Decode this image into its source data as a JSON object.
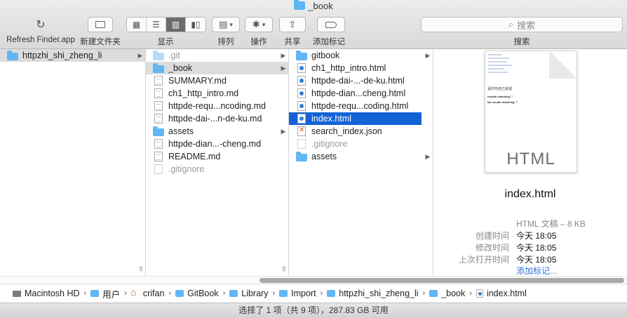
{
  "window": {
    "title": "_book"
  },
  "toolbar": {
    "refresh_label": "Refresh Finder.app",
    "new_folder_label": "新建文件夹",
    "view_label": "显示",
    "arrange_label": "排列",
    "action_label": "操作",
    "share_label": "共享",
    "tags_label": "添加标记",
    "search_placeholder": "搜索",
    "search_label": "搜索"
  },
  "columns": [
    {
      "items": [
        {
          "name": "httpzhi_shi_zheng_li",
          "icon": "folder-icon",
          "folder": true,
          "state": "path"
        }
      ]
    },
    {
      "items": [
        {
          "name": ".git",
          "icon": "folder-icon",
          "folder": true,
          "dim": true
        },
        {
          "name": "_book",
          "icon": "folder-icon",
          "folder": true,
          "state": "path"
        },
        {
          "name": "SUMMARY.md",
          "icon": "document-icon"
        },
        {
          "name": "ch1_http_intro.md",
          "icon": "document-icon"
        },
        {
          "name": "httpde-requ...ncoding.md",
          "icon": "document-icon"
        },
        {
          "name": "httpde-dai-...n-de-ku.md",
          "icon": "document-icon"
        },
        {
          "name": "assets",
          "icon": "folder-icon",
          "folder": true
        },
        {
          "name": "httpde-dian...-cheng.md",
          "icon": "document-icon"
        },
        {
          "name": "README.md",
          "icon": "document-icon"
        },
        {
          "name": ".gitignore",
          "icon": "document-icon",
          "dim": true
        }
      ]
    },
    {
      "items": [
        {
          "name": "gitbook",
          "icon": "folder-icon",
          "folder": true
        },
        {
          "name": "ch1_http_intro.html",
          "icon": "html-file-icon"
        },
        {
          "name": "httpde-dai-...-de-ku.html",
          "icon": "html-file-icon"
        },
        {
          "name": "httpde-dian...cheng.html",
          "icon": "html-file-icon"
        },
        {
          "name": "httpde-requ...coding.html",
          "icon": "html-file-icon"
        },
        {
          "name": "index.html",
          "icon": "html-file-icon",
          "state": "selected"
        },
        {
          "name": "search_index.json",
          "icon": "json-file-icon"
        },
        {
          "name": ".gitignore",
          "icon": "document-icon",
          "dim": true
        },
        {
          "name": "assets",
          "icon": "folder-icon",
          "folder": true
        }
      ]
    }
  ],
  "preview": {
    "thumbnail_kind": "HTML",
    "thumbnail_text": {
      "heading": "请开你自己说说",
      "line1": "results matching \"\"",
      "line2": "No results matching \"\""
    },
    "filename": "index.html",
    "kind_size": "HTML 文稿 – 8 KB",
    "meta": [
      {
        "key": "创建时间",
        "value": "今天 18:05"
      },
      {
        "key": "修改时间",
        "value": "今天 18:05"
      },
      {
        "key": "上次打开时间",
        "value": "今天 18:05"
      }
    ],
    "add_tags": "添加标记..."
  },
  "path": [
    {
      "label": "Macintosh HD",
      "icon": "disk-icon"
    },
    {
      "label": "用户",
      "icon": "folder-icon"
    },
    {
      "label": "crifan",
      "icon": "home-icon"
    },
    {
      "label": "GitBook",
      "icon": "folder-icon"
    },
    {
      "label": "Library",
      "icon": "folder-icon"
    },
    {
      "label": "Import",
      "icon": "folder-icon"
    },
    {
      "label": "httpzhi_shi_zheng_li",
      "icon": "folder-icon"
    },
    {
      "label": "_book",
      "icon": "folder-icon"
    },
    {
      "label": "index.html",
      "icon": "html-file-icon"
    }
  ],
  "status": {
    "text": "选择了 1 项（共 9 项），287.83 GB 可用"
  },
  "colors": {
    "selection": "#1363d6",
    "folder": "#62b6f4",
    "link": "#2f6fd8"
  }
}
